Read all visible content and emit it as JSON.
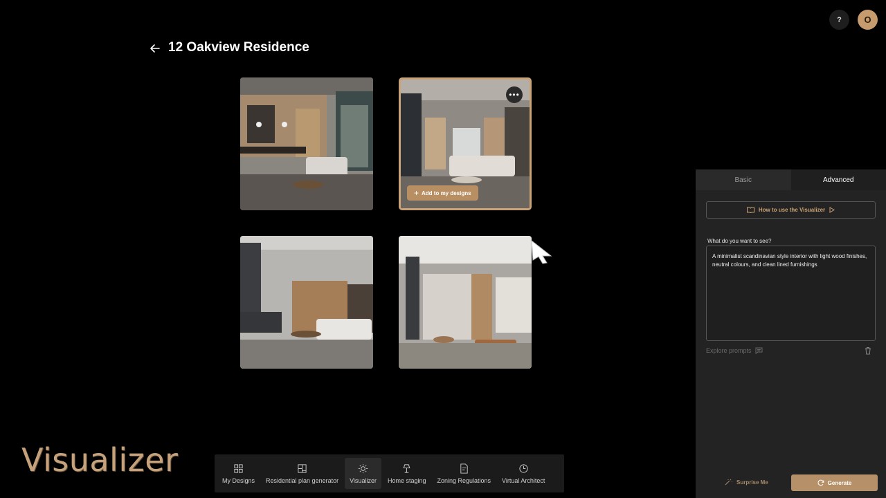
{
  "header": {
    "title": "12 Oakview Residence",
    "help_label": "?",
    "avatar_initial": "O"
  },
  "gallery": {
    "more_label": "•••",
    "add_label": "Add to my designs"
  },
  "watermark": "Visualizer",
  "bottom_nav": {
    "items": [
      {
        "label": "My Designs",
        "icon": "grid-icon"
      },
      {
        "label": "Residential plan generator",
        "icon": "floorplan-icon"
      },
      {
        "label": "Visualizer",
        "icon": "sun-icon",
        "active": true
      },
      {
        "label": "Home staging",
        "icon": "lamp-icon"
      },
      {
        "label": "Zoning Regulations",
        "icon": "document-icon"
      },
      {
        "label": "Virtual Architect",
        "icon": "compass-icon"
      }
    ]
  },
  "panel": {
    "tabs": [
      "Basic",
      "Advanced"
    ],
    "active_tab": "Advanced",
    "howto_label": "How to use the Visualizer",
    "prompt_label": "What do you want to see?",
    "prompt_value": "A minimalist scandinavian style interior with light wood finishes, neutral colours, and clean lined furnishings",
    "explore_label": "Explore prompts",
    "surprise_label": "Surprise Me",
    "generate_label": "Generate"
  },
  "colors": {
    "accent": "#c9a275",
    "panel_bg": "#232323",
    "generate_bg": "#b69068"
  }
}
